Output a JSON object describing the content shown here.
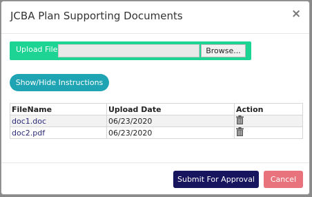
{
  "modal": {
    "title": "JCBA Plan Supporting Documents",
    "close_symbol": "×"
  },
  "upload": {
    "label": "Upload File",
    "browse_label": "Browse...",
    "file_value": ""
  },
  "instructions_button": "Show/Hide Instructions",
  "table": {
    "headers": [
      "FileName",
      "Upload Date",
      "Action"
    ],
    "rows": [
      {
        "filename": "doc1.doc",
        "date": "06/23/2020",
        "action_icon": "trash-icon"
      },
      {
        "filename": "doc2.pdf",
        "date": "06/23/2020",
        "action_icon": "trash-icon"
      }
    ]
  },
  "footer": {
    "submit_label": "Submit For Approval",
    "cancel_label": "Cancel"
  },
  "colors": {
    "upload_bg": "#1dd494",
    "instructions_bg": "#1fa4b4",
    "submit_bg": "#17155e",
    "cancel_bg": "#e8737d",
    "link": "#2c2a78"
  }
}
